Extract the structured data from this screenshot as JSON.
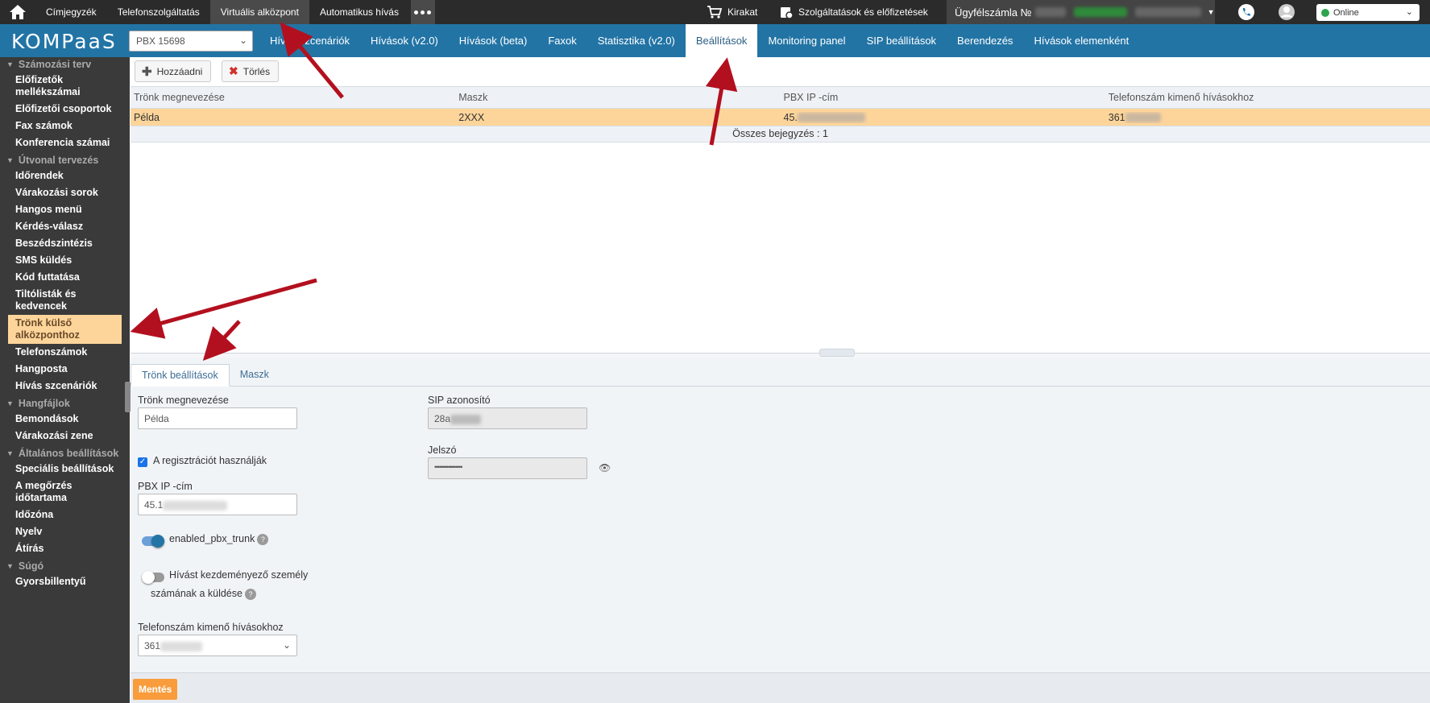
{
  "topbar": {
    "nav": [
      "Címjegyzék",
      "Telefonszolgáltatás",
      "Virtuális alközpont",
      "Automatikus hívás"
    ],
    "active_nav": "Virtuális alközpont",
    "kirakat": "Kirakat",
    "services": "Szolgáltatások és előfizetések",
    "account_label": "Ügyfélszámla №",
    "status": "Online"
  },
  "navbar": {
    "logo": "KOMPaaS",
    "pbx_select": "PBX 15698",
    "tabs": [
      "Hívás szcenáriók",
      "Hívások (v2.0)",
      "Hívások (beta)",
      "Faxok",
      "Statisztika (v2.0)",
      "Beállítások",
      "Monitoring panel",
      "SIP beállítások",
      "Berendezés",
      "Hívások elemenként"
    ],
    "active_tab": "Beállítások"
  },
  "sidebar": {
    "groups": [
      {
        "title": "Számozási terv",
        "items": [
          "Előfizetők mellékszámai",
          "Előfizetői csoportok",
          "Fax számok",
          "Konferencia számai"
        ]
      },
      {
        "title": "Útvonal tervezés",
        "items": [
          "Időrendek",
          "Várakozási sorok",
          "Hangos menü",
          "Kérdés-válasz",
          "Beszédszintézis",
          "SMS küldés",
          "Kód futtatása",
          "Tiltólisták és kedvencek",
          "Trönk külső alközponthoz",
          "Telefonszámok",
          "Hangposta",
          "Hívás szcenáriók"
        ]
      },
      {
        "title": "Hangfájlok",
        "items": [
          "Bemondások",
          "Várakozási zene"
        ]
      },
      {
        "title": "Általános beállítások",
        "items": [
          "Speciális beállítások",
          "A megőrzés időtartama",
          "Időzóna",
          "Nyelv",
          "Átírás"
        ]
      },
      {
        "title": "Súgó",
        "items": [
          "Gyorsbillentyű"
        ]
      }
    ],
    "active_item": "Trönk külső alközponthoz"
  },
  "toolbar": {
    "add": "Hozzáadni",
    "delete": "Törlés"
  },
  "table": {
    "columns": [
      "Trönk megnevezése",
      "Maszk",
      "PBX IP -cím",
      "Telefonszám kimenő hívásokhoz"
    ],
    "rows": [
      [
        "Példa",
        "2XXX",
        "45.",
        "361"
      ]
    ],
    "footer": "Összes bejegyzés : 1"
  },
  "form": {
    "tabs": [
      "Trönk beállítások",
      "Maszk"
    ],
    "active_tab": "Trönk beállítások",
    "trunk_name_label": "Trönk megnevezése",
    "trunk_name_value": "Példa",
    "sip_id_label": "SIP azonosító",
    "sip_id_value": "28a",
    "password_label": "Jelszó",
    "password_value": "••••••••••••••••",
    "use_registration_label": "A regisztrációt használják",
    "use_registration_checked": true,
    "pbx_ip_label": "PBX IP -cím",
    "pbx_ip_value": "45.1",
    "enabled_pbx_trunk_label": "enabled_pbx_trunk",
    "enabled_pbx_trunk_on": true,
    "send_caller_label_line1": "Hívást kezdeményező személy",
    "send_caller_label_line2": "számának a küldése",
    "send_caller_on": false,
    "outgoing_label": "Telefonszám kimenő hívásokhoz",
    "outgoing_value": "361",
    "save": "Mentés"
  },
  "colors": {
    "topbar": "#2b2b2b",
    "navbar": "#2274a5",
    "sidebar": "#3a3a3a",
    "highlight": "#fdd59b",
    "save": "#f89c3c",
    "annotation_arrow": "#b3101f"
  }
}
